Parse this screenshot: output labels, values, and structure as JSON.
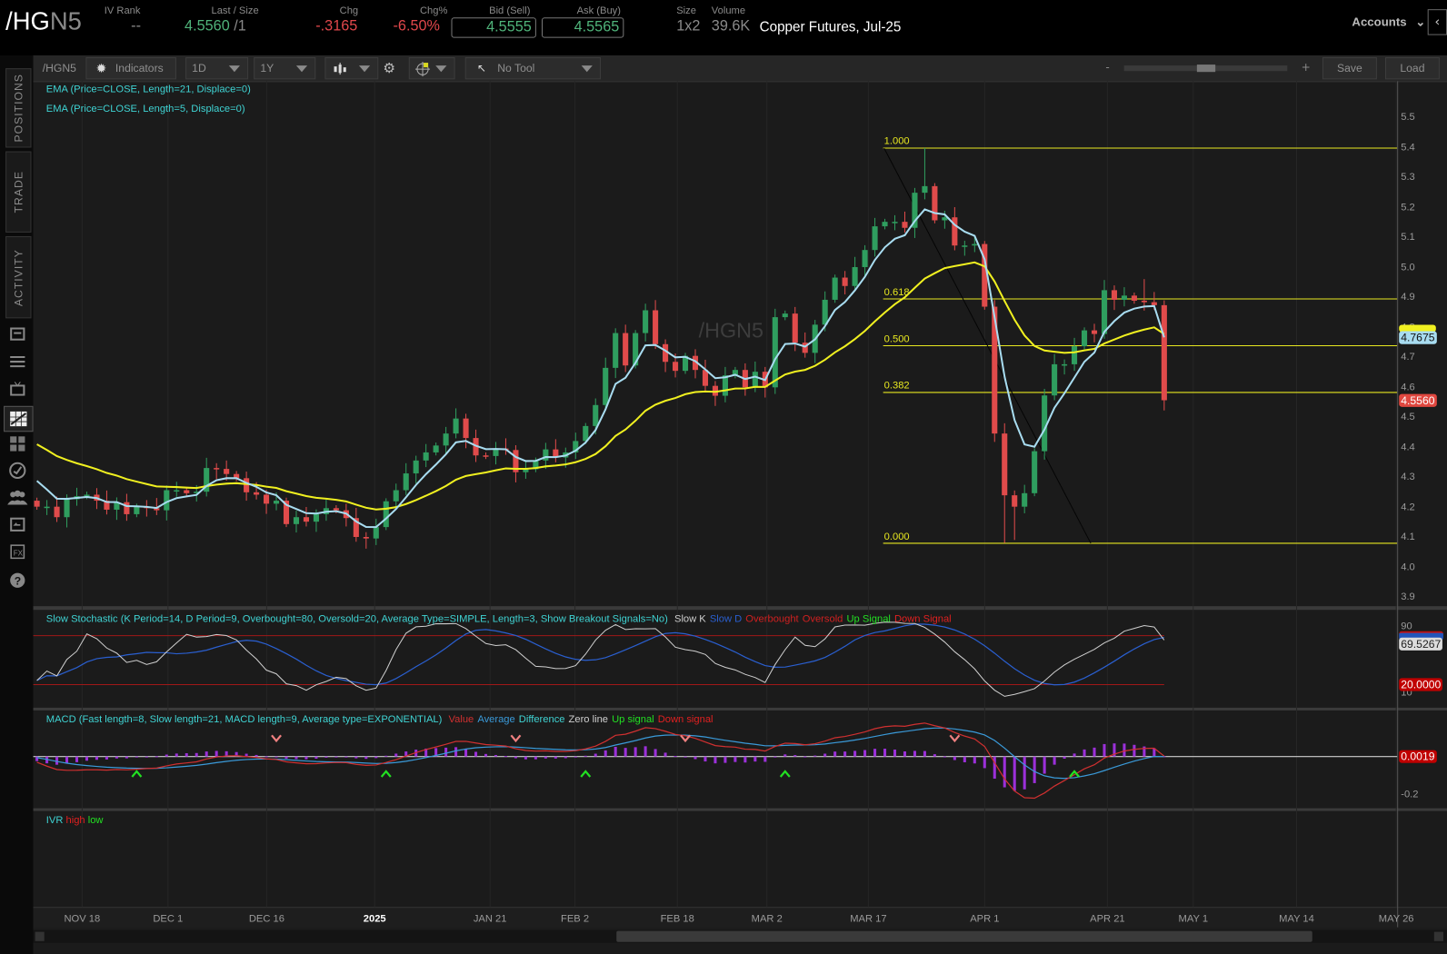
{
  "header": {
    "symbol_main": "/HG",
    "symbol_suffix": "N5",
    "iv_rank_label": "IV Rank",
    "iv_rank": "--",
    "last_label": "Last / Size",
    "last": "4.5560",
    "last_size": "/1",
    "chg_label": "Chg",
    "chg": "-.3165",
    "chgpct_label": "Chg%",
    "chgpct": "-6.50%",
    "bid_label": "Bid (Sell)",
    "bid": "4.5555",
    "ask_label": "Ask (Buy)",
    "ask": "4.5565",
    "size_label": "Size",
    "size": "1x2",
    "volume_label": "Volume",
    "volume": "39.6K",
    "description": "Copper Futures, Jul-25",
    "accounts": "Accounts"
  },
  "sidebar": {
    "tabs": [
      "POSITIONS",
      "TRADE",
      "ACTIVITY"
    ],
    "icons": [
      "news-icon",
      "list-icon",
      "tv-icon",
      "charts-icon",
      "grid-icon",
      "analyze-icon",
      "community-icon",
      "calendar-icon",
      "fx-icon",
      "help-icon"
    ],
    "active_icon": "charts-icon"
  },
  "toolbar": {
    "symbol": "/HGN5",
    "indicators": "Indicators",
    "aggregation": "1D",
    "period": "1Y",
    "tool": "No Tool",
    "zoom_minus": "-",
    "zoom_plus": "+",
    "save": "Save",
    "load": "Load"
  },
  "studies": {
    "ema21": "EMA (Price=CLOSE, Length=21, Displace=0)",
    "ema5": "EMA (Price=CLOSE, Length=5, Displace=0)"
  },
  "watermark": "/HGN5",
  "fib_levels": [
    {
      "label": "1.000",
      "value": 5.397
    },
    {
      "label": "0.618",
      "value": 4.894
    },
    {
      "label": "0.500",
      "value": 4.738
    },
    {
      "label": "0.382",
      "value": 4.582
    },
    {
      "label": "0.000",
      "value": 4.079
    }
  ],
  "price_axis": {
    "ticks": [
      "5.5",
      "5.4",
      "5.3",
      "5.2",
      "5.1",
      "5.0",
      "4.9",
      "4.8",
      "4.7",
      "4.6",
      "4.5",
      "4.4",
      "4.3",
      "4.2",
      "4.1",
      "4.0",
      "3.9"
    ],
    "badge_ema": "4.7675",
    "badge_last": "4.5560"
  },
  "stochastic": {
    "title": "Slow Stochastic (K Period=14, D Period=9, Overbought=80, Oversold=20, Average Type=SIMPLE, Length=3, Show Breakout Signals=No)",
    "legend": [
      {
        "label": "Slow K",
        "color": "#cfcfcf"
      },
      {
        "label": "Slow D",
        "color": "#2a5fd0"
      },
      {
        "label": "Overbought",
        "color": "#d02020"
      },
      {
        "label": "Oversold",
        "color": "#d02020"
      },
      {
        "label": "Up Signal",
        "color": "#22e022"
      },
      {
        "label": "Down Signal",
        "color": "#e02020"
      }
    ],
    "overbought": 80,
    "oversold": 20,
    "axis": [
      "90",
      "10"
    ],
    "badge_k": "69.5267",
    "badge_os": "20.0000"
  },
  "macd": {
    "title": "MACD (Fast length=8, Slow length=21, MACD length=9, Average type=EXPONENTIAL)",
    "legend": [
      {
        "label": "Value",
        "color": "#d03030"
      },
      {
        "label": "Average",
        "color": "#3a9ad9"
      },
      {
        "label": "Difference",
        "color": "#3fd3d3"
      },
      {
        "label": "Zero line",
        "color": "#cfcfcf"
      },
      {
        "label": "Up signal",
        "color": "#22e022"
      },
      {
        "label": "Down signal",
        "color": "#e02020"
      }
    ],
    "axis": [
      "-0.2"
    ],
    "badge": "0.0019",
    "up_signals": [
      10,
      35,
      55,
      75,
      104
    ],
    "down_signals": [
      24,
      48,
      65,
      92
    ]
  },
  "ivr": {
    "label": "IVR",
    "high": "high",
    "low": "low"
  },
  "x_axis": [
    "NOV 18",
    "DEC 1",
    "DEC 16",
    "2025",
    "JAN 21",
    "FEB 2",
    "FEB 18",
    "MAR 2",
    "MAR 17",
    "APR 1",
    "APR 21",
    "MAY 1",
    "MAY 14",
    "MAY 26"
  ],
  "colors": {
    "up": "#2f9e5f",
    "down": "#e04b4b",
    "ema5": "#a8dcf0",
    "ema21": "#f0f020",
    "fib": "#e8e820",
    "macd_hist": "#9b30d9"
  },
  "chart_data": {
    "type": "candlestick",
    "symbol": "/HGN5",
    "aggregation": "1D",
    "closes": [
      4.201,
      4.201,
      4.166,
      4.226,
      4.236,
      4.241,
      4.221,
      4.191,
      4.216,
      4.176,
      4.201,
      4.196,
      4.189,
      4.256,
      4.256,
      4.246,
      4.251,
      4.33,
      4.327,
      4.31,
      4.296,
      4.249,
      4.241,
      4.211,
      4.221,
      4.143,
      4.166,
      4.151,
      4.176,
      4.196,
      4.189,
      4.163,
      4.1,
      4.095,
      4.133,
      4.219,
      4.256,
      4.312,
      4.355,
      4.382,
      4.405,
      4.445,
      4.495,
      4.43,
      4.372,
      4.37,
      4.395,
      4.39,
      4.316,
      4.326,
      4.355,
      4.392,
      4.365,
      4.382,
      4.42,
      4.47,
      4.54,
      4.664,
      4.78,
      4.672,
      4.78,
      4.856,
      4.743,
      4.684,
      4.654,
      4.704,
      4.657,
      4.604,
      4.571,
      4.639,
      4.657,
      4.599,
      4.651,
      4.599,
      4.833,
      4.845,
      4.748,
      4.714,
      4.808,
      4.891,
      4.965,
      4.937,
      5.0,
      5.057,
      5.136,
      5.151,
      5.151,
      5.131,
      5.248,
      5.27,
      5.156,
      5.166,
      5.072,
      5.072,
      5.077,
      4.868,
      4.445,
      4.239,
      4.201,
      4.246,
      4.386,
      4.572,
      4.676,
      4.676,
      4.736,
      4.789,
      4.777,
      4.923,
      4.891,
      4.905,
      4.888,
      4.883,
      4.873,
      4.556
    ],
    "wick_overrides": [
      {
        "i": 89,
        "h": 5.397
      },
      {
        "i": 97,
        "l": 4.08
      },
      {
        "i": 98,
        "l": 4.09
      },
      {
        "i": 111,
        "h": 4.96
      }
    ],
    "ema21_start": 4.43,
    "ema5_start": 4.33,
    "y_range": [
      3.85,
      5.55
    ]
  }
}
